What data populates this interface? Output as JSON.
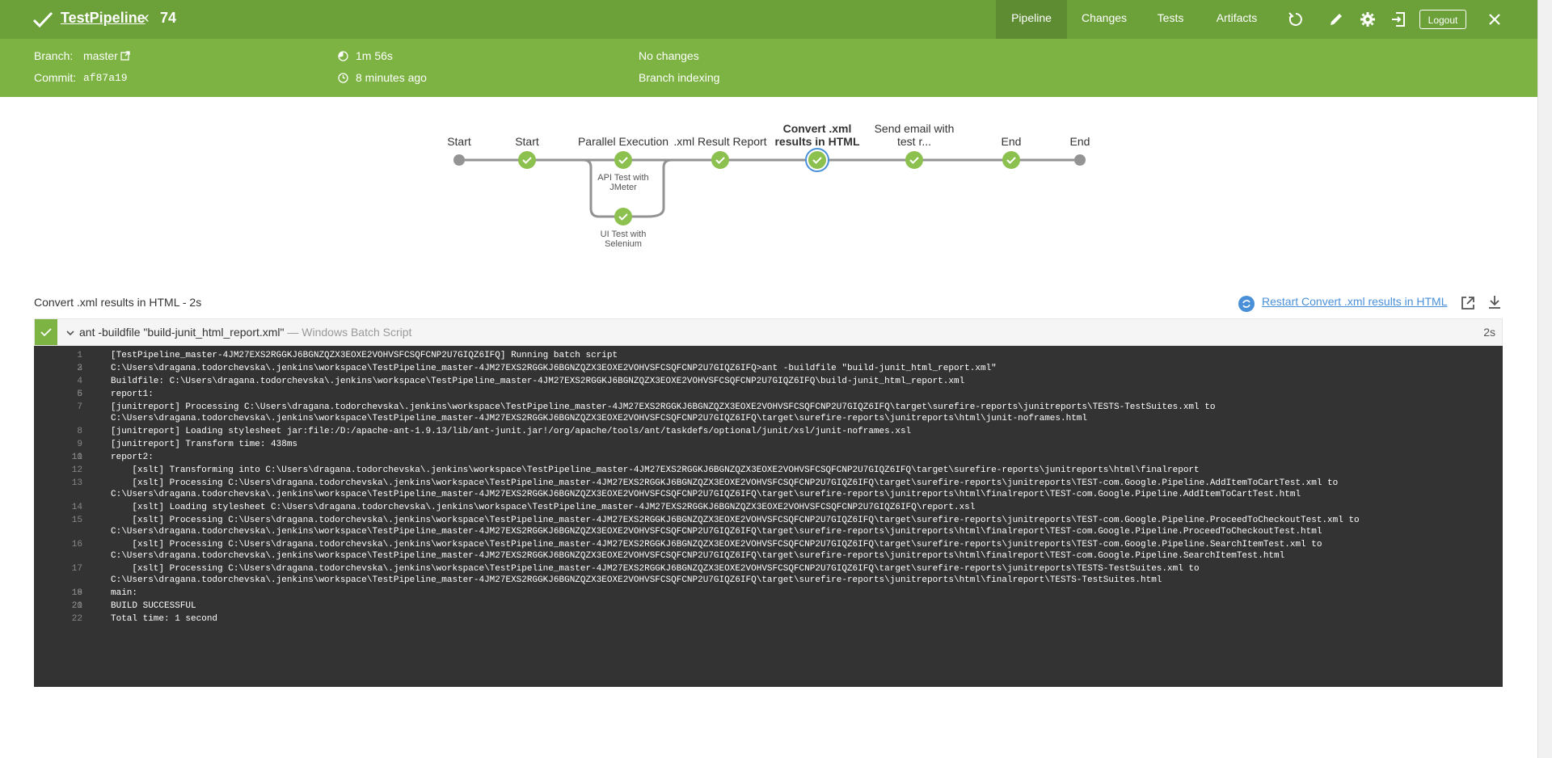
{
  "header": {
    "title": "TestPipeline",
    "run_number": "74",
    "tabs": [
      {
        "label": "Pipeline",
        "active": true
      },
      {
        "label": "Changes",
        "active": false
      },
      {
        "label": "Tests",
        "active": false
      },
      {
        "label": "Artifacts",
        "active": false
      }
    ],
    "logout_label": "Logout",
    "icons": [
      "rerun-icon",
      "edit-icon",
      "gear-icon",
      "exit-to-classic-icon",
      "close-icon"
    ],
    "colors": {
      "bar": "#6ca13a",
      "summary": "#7cb342"
    }
  },
  "summary": {
    "branch_label": "Branch:",
    "branch_value": "master",
    "commit_label": "Commit:",
    "commit_value": "af87a19",
    "duration": "1m 56s",
    "time_ago": "8 minutes ago",
    "changes": "No changes",
    "cause": "Branch indexing"
  },
  "graph": {
    "stages": [
      {
        "label": "Start",
        "status": "start"
      },
      {
        "label": "Start",
        "status": "success"
      },
      {
        "label": "Parallel Execution",
        "status": "success"
      },
      {
        "label": ".xml Result Report",
        "status": "success"
      },
      {
        "label": "Convert .xml results in HTML",
        "status": "selected"
      },
      {
        "label": "Send email with test r...",
        "status": "success"
      },
      {
        "label": "End",
        "status": "success"
      },
      {
        "label": "End",
        "status": "end"
      }
    ],
    "parallel_branches": [
      {
        "label": "API Test with JMeter"
      },
      {
        "label": "UI Test with Selenium"
      }
    ]
  },
  "step_panel": {
    "title": "Convert .xml results in HTML - 2s",
    "restart_label": "Restart Convert .xml results in HTML",
    "step_command": "ant -buildfile \"build-junit_html_report.xml\"",
    "step_type": "— Windows Batch Script",
    "step_duration": "2s"
  },
  "log_lines": [
    {
      "n": "1",
      "text": "[TestPipeline_master-4JM27EXS2RGGKJ6BGNZQZX3EOXE2VOHVSFCSQFCNP2U7GIQZ6IFQ] Running batch script"
    },
    {
      "n": "2",
      "text": ""
    },
    {
      "n": "3",
      "text": "C:\\Users\\dragana.todorchevska\\.jenkins\\workspace\\TestPipeline_master-4JM27EXS2RGGKJ6BGNZQZX3EOXE2VOHVSFCSQFCNP2U7GIQZ6IFQ>ant -buildfile \"build-junit_html_report.xml\""
    },
    {
      "n": "4",
      "text": "Buildfile: C:\\Users\\dragana.todorchevska\\.jenkins\\workspace\\TestPipeline_master-4JM27EXS2RGGKJ6BGNZQZX3EOXE2VOHVSFCSQFCNP2U7GIQZ6IFQ\\build-junit_html_report.xml"
    },
    {
      "n": "5",
      "text": ""
    },
    {
      "n": "6",
      "text": "report1:"
    },
    {
      "n": "7",
      "text": "[junitreport] Processing C:\\Users\\dragana.todorchevska\\.jenkins\\workspace\\TestPipeline_master-4JM27EXS2RGGKJ6BGNZQZX3EOXE2VOHVSFCSQFCNP2U7GIQZ6IFQ\\target\\surefire-reports\\junitreports\\TESTS-TestSuites.xml to\nC:\\Users\\dragana.todorchevska\\.jenkins\\workspace\\TestPipeline_master-4JM27EXS2RGGKJ6BGNZQZX3EOXE2VOHVSFCSQFCNP2U7GIQZ6IFQ\\target\\surefire-reports\\junitreports\\html\\junit-noframes.html"
    },
    {
      "n": "8",
      "text": "[junitreport] Loading stylesheet jar:file:/D:/apache-ant-1.9.13/lib/ant-junit.jar!/org/apache/tools/ant/taskdefs/optional/junit/xsl/junit-noframes.xsl"
    },
    {
      "n": "9",
      "text": "[junitreport] Transform time: 438ms"
    },
    {
      "n": "10",
      "text": ""
    },
    {
      "n": "11",
      "text": "report2:"
    },
    {
      "n": "12",
      "text": "    [xslt] Transforming into C:\\Users\\dragana.todorchevska\\.jenkins\\workspace\\TestPipeline_master-4JM27EXS2RGGKJ6BGNZQZX3EOXE2VOHVSFCSQFCNP2U7GIQZ6IFQ\\target\\surefire-reports\\junitreports\\html\\finalreport"
    },
    {
      "n": "13",
      "text": "    [xslt] Processing C:\\Users\\dragana.todorchevska\\.jenkins\\workspace\\TestPipeline_master-4JM27EXS2RGGKJ6BGNZQZX3EOXE2VOHVSFCSQFCNP2U7GIQZ6IFQ\\target\\surefire-reports\\junitreports\\TEST-com.Google.Pipeline.AddItemToCartTest.xml to\nC:\\Users\\dragana.todorchevska\\.jenkins\\workspace\\TestPipeline_master-4JM27EXS2RGGKJ6BGNZQZX3EOXE2VOHVSFCSQFCNP2U7GIQZ6IFQ\\target\\surefire-reports\\junitreports\\html\\finalreport\\TEST-com.Google.Pipeline.AddItemToCartTest.html"
    },
    {
      "n": "14",
      "text": "    [xslt] Loading stylesheet C:\\Users\\dragana.todorchevska\\.jenkins\\workspace\\TestPipeline_master-4JM27EXS2RGGKJ6BGNZQZX3EOXE2VOHVSFCSQFCNP2U7GIQZ6IFQ\\report.xsl"
    },
    {
      "n": "15",
      "text": "    [xslt] Processing C:\\Users\\dragana.todorchevska\\.jenkins\\workspace\\TestPipeline_master-4JM27EXS2RGGKJ6BGNZQZX3EOXE2VOHVSFCSQFCNP2U7GIQZ6IFQ\\target\\surefire-reports\\junitreports\\TEST-com.Google.Pipeline.ProceedToCheckoutTest.xml to\nC:\\Users\\dragana.todorchevska\\.jenkins\\workspace\\TestPipeline_master-4JM27EXS2RGGKJ6BGNZQZX3EOXE2VOHVSFCSQFCNP2U7GIQZ6IFQ\\target\\surefire-reports\\junitreports\\html\\finalreport\\TEST-com.Google.Pipeline.ProceedToCheckoutTest.html"
    },
    {
      "n": "16",
      "text": "    [xslt] Processing C:\\Users\\dragana.todorchevska\\.jenkins\\workspace\\TestPipeline_master-4JM27EXS2RGGKJ6BGNZQZX3EOXE2VOHVSFCSQFCNP2U7GIQZ6IFQ\\target\\surefire-reports\\junitreports\\TEST-com.Google.Pipeline.SearchItemTest.xml to\nC:\\Users\\dragana.todorchevska\\.jenkins\\workspace\\TestPipeline_master-4JM27EXS2RGGKJ6BGNZQZX3EOXE2VOHVSFCSQFCNP2U7GIQZ6IFQ\\target\\surefire-reports\\junitreports\\html\\finalreport\\TEST-com.Google.Pipeline.SearchItemTest.html"
    },
    {
      "n": "17",
      "text": "    [xslt] Processing C:\\Users\\dragana.todorchevska\\.jenkins\\workspace\\TestPipeline_master-4JM27EXS2RGGKJ6BGNZQZX3EOXE2VOHVSFCSQFCNP2U7GIQZ6IFQ\\target\\surefire-reports\\junitreports\\TESTS-TestSuites.xml to\nC:\\Users\\dragana.todorchevska\\.jenkins\\workspace\\TestPipeline_master-4JM27EXS2RGGKJ6BGNZQZX3EOXE2VOHVSFCSQFCNP2U7GIQZ6IFQ\\target\\surefire-reports\\junitreports\\html\\finalreport\\TESTS-TestSuites.html"
    },
    {
      "n": "18",
      "text": ""
    },
    {
      "n": "19",
      "text": "main:"
    },
    {
      "n": "20",
      "text": ""
    },
    {
      "n": "21",
      "text": "BUILD SUCCESSFUL"
    },
    {
      "n": "22",
      "text": "Total time: 1 second"
    }
  ]
}
